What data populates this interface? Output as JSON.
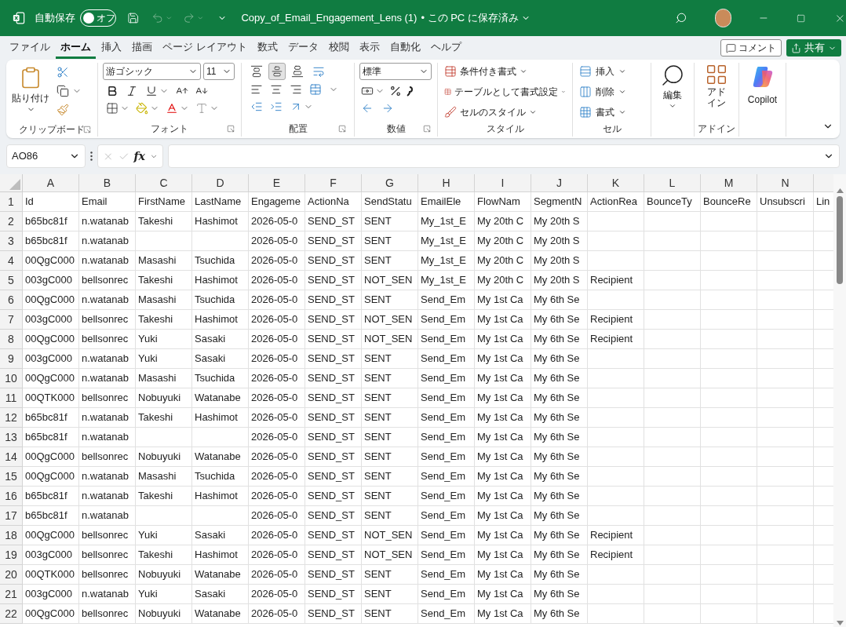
{
  "title_bar": {
    "autosave_label": "自動保存",
    "autosave": {
      "label": "オフ",
      "on": false
    },
    "filename": "Copy_of_Email_Engagement_Lens (1)",
    "save_status": "• この PC に保存済み"
  },
  "menu_tabs": [
    {
      "label": "ファイル",
      "selected": false
    },
    {
      "label": "ホーム",
      "selected": true
    },
    {
      "label": "挿入",
      "selected": false
    },
    {
      "label": "描画",
      "selected": false
    },
    {
      "label": "ページ レイアウト",
      "selected": false
    },
    {
      "label": "数式",
      "selected": false
    },
    {
      "label": "データ",
      "selected": false
    },
    {
      "label": "校閲",
      "selected": false
    },
    {
      "label": "表示",
      "selected": false
    },
    {
      "label": "自動化",
      "selected": false
    },
    {
      "label": "ヘルプ",
      "selected": false
    }
  ],
  "comment_button": "コメント",
  "share_button": "共有",
  "ribbon": {
    "clipboard": {
      "paste": "貼り付け",
      "label": "クリップボード"
    },
    "font": {
      "name": "游ゴシック",
      "size": "11",
      "label": "フォント"
    },
    "alignment": {
      "vertical": [
        {
          "selected": false
        },
        {
          "selected": true
        },
        {
          "selected": false
        }
      ],
      "label": "配置"
    },
    "number": {
      "format": "標準",
      "label": "数値"
    },
    "styles": {
      "items": [
        "条件付き書式",
        "テーブルとして書式設定",
        "セルのスタイル"
      ],
      "label": "スタイル"
    },
    "cells": {
      "items": [
        "挿入",
        "削除",
        "書式"
      ],
      "label": "セル"
    },
    "editing": {
      "label": "編集"
    },
    "addins": {
      "button": "アドイン",
      "label": "アドイン"
    },
    "copilot": {
      "label": "Copilot"
    }
  },
  "formula_bar": {
    "name_box": "AO86",
    "fx": "fx"
  },
  "sheet": {
    "columns": [
      "A",
      "B",
      "C",
      "D",
      "E",
      "F",
      "G",
      "H",
      "I",
      "J",
      "K",
      "L",
      "M",
      "N"
    ],
    "rows": [
      {
        "number": "1",
        "cells": [
          "Id",
          "Email",
          "FirstName",
          "LastName",
          "Engageme",
          "ActionNa",
          "SendStatu",
          "EmailEle",
          "FlowNam",
          "SegmentN",
          "ActionRea",
          "BounceTy",
          "BounceRe",
          "Unsubscri",
          "Lin"
        ]
      },
      {
        "number": "2",
        "cells": [
          "b65bc81f",
          "n.watanab",
          "Takeshi",
          "Hashimot",
          "2026-05-0",
          "SEND_ST",
          "SENT",
          "My_1st_E",
          "My 20th C",
          "My 20th S"
        ]
      },
      {
        "number": "3",
        "cells": [
          "b65bc81f",
          "n.watanab",
          null,
          null,
          "2026-05-0",
          "SEND_ST",
          "SENT",
          "My_1st_E",
          "My 20th C",
          "My 20th S"
        ]
      },
      {
        "number": "4",
        "cells": [
          "00QgC000",
          "n.watanab",
          "Masashi",
          "Tsuchida",
          "2026-05-0",
          "SEND_ST",
          "SENT",
          "My_1st_E",
          "My 20th C",
          "My 20th S"
        ]
      },
      {
        "number": "5",
        "cells": [
          "003gC000",
          "bellsonrec",
          "Takeshi",
          "Hashimot",
          "2026-05-0",
          "SEND_ST",
          "NOT_SEN",
          "My_1st_E",
          "My 20th C",
          "My 20th S",
          "Recipient"
        ]
      },
      {
        "number": "6",
        "cells": [
          "00QgC000",
          "n.watanab",
          "Masashi",
          "Tsuchida",
          "2026-05-0",
          "SEND_ST",
          "SENT",
          "Send_Em",
          "My 1st Ca",
          "My 6th Se"
        ]
      },
      {
        "number": "7",
        "cells": [
          "003gC000",
          "bellsonrec",
          "Takeshi",
          "Hashimot",
          "2026-05-0",
          "SEND_ST",
          "NOT_SEN",
          "Send_Em",
          "My 1st Ca",
          "My 6th Se",
          "Recipient"
        ]
      },
      {
        "number": "8",
        "cells": [
          "00QgC000",
          "bellsonrec",
          "Yuki",
          "Sasaki",
          "2026-05-0",
          "SEND_ST",
          "NOT_SEN",
          "Send_Em",
          "My 1st Ca",
          "My 6th Se",
          "Recipient"
        ]
      },
      {
        "number": "9",
        "cells": [
          "003gC000",
          "n.watanab",
          "Yuki",
          "Sasaki",
          "2026-05-0",
          "SEND_ST",
          "SENT",
          "Send_Em",
          "My 1st Ca",
          "My 6th Se"
        ]
      },
      {
        "number": "10",
        "cells": [
          "00QgC000",
          "n.watanab",
          "Masashi",
          "Tsuchida",
          "2026-05-0",
          "SEND_ST",
          "SENT",
          "Send_Em",
          "My 1st Ca",
          "My 6th Se"
        ]
      },
      {
        "number": "11",
        "cells": [
          "00QTK000",
          "bellsonrec",
          "Nobuyuki",
          "Watanabe",
          "2026-05-0",
          "SEND_ST",
          "SENT",
          "Send_Em",
          "My 1st Ca",
          "My 6th Se"
        ]
      },
      {
        "number": "12",
        "cells": [
          "b65bc81f",
          "n.watanab",
          "Takeshi",
          "Hashimot",
          "2026-05-0",
          "SEND_ST",
          "SENT",
          "Send_Em",
          "My 1st Ca",
          "My 6th Se"
        ]
      },
      {
        "number": "13",
        "cells": [
          "b65bc81f",
          "n.watanab",
          null,
          null,
          "2026-05-0",
          "SEND_ST",
          "SENT",
          "Send_Em",
          "My 1st Ca",
          "My 6th Se"
        ]
      },
      {
        "number": "14",
        "cells": [
          "00QgC000",
          "bellsonrec",
          "Nobuyuki",
          "Watanabe",
          "2026-05-0",
          "SEND_ST",
          "SENT",
          "Send_Em",
          "My 1st Ca",
          "My 6th Se"
        ]
      },
      {
        "number": "15",
        "cells": [
          "00QgC000",
          "n.watanab",
          "Masashi",
          "Tsuchida",
          "2026-05-0",
          "SEND_ST",
          "SENT",
          "Send_Em",
          "My 1st Ca",
          "My 6th Se"
        ]
      },
      {
        "number": "16",
        "cells": [
          "b65bc81f",
          "n.watanab",
          "Takeshi",
          "Hashimot",
          "2026-05-0",
          "SEND_ST",
          "SENT",
          "Send_Em",
          "My 1st Ca",
          "My 6th Se"
        ]
      },
      {
        "number": "17",
        "cells": [
          "b65bc81f",
          "n.watanab",
          null,
          null,
          "2026-05-0",
          "SEND_ST",
          "SENT",
          "Send_Em",
          "My 1st Ca",
          "My 6th Se"
        ]
      },
      {
        "number": "18",
        "cells": [
          "00QgC000",
          "bellsonrec",
          "Yuki",
          "Sasaki",
          "2026-05-0",
          "SEND_ST",
          "NOT_SEN",
          "Send_Em",
          "My 1st Ca",
          "My 6th Se",
          "Recipient"
        ]
      },
      {
        "number": "19",
        "cells": [
          "003gC000",
          "bellsonrec",
          "Takeshi",
          "Hashimot",
          "2026-05-0",
          "SEND_ST",
          "NOT_SEN",
          "Send_Em",
          "My 1st Ca",
          "My 6th Se",
          "Recipient"
        ]
      },
      {
        "number": "20",
        "cells": [
          "00QTK000",
          "bellsonrec",
          "Nobuyuki",
          "Watanabe",
          "2026-05-0",
          "SEND_ST",
          "SENT",
          "Send_Em",
          "My 1st Ca",
          "My 6th Se"
        ]
      },
      {
        "number": "21",
        "cells": [
          "003gC000",
          "n.watanab",
          "Yuki",
          "Sasaki",
          "2026-05-0",
          "SEND_ST",
          "SENT",
          "Send_Em",
          "My 1st Ca",
          "My 6th Se"
        ]
      },
      {
        "number": "22",
        "cells": [
          "00QgC000",
          "bellsonrec",
          "Nobuyuki",
          "Watanabe",
          "2026-05-0",
          "SEND_ST",
          "SENT",
          "Send_Em",
          "My 1st Ca",
          "My 6th Se"
        ]
      }
    ]
  }
}
